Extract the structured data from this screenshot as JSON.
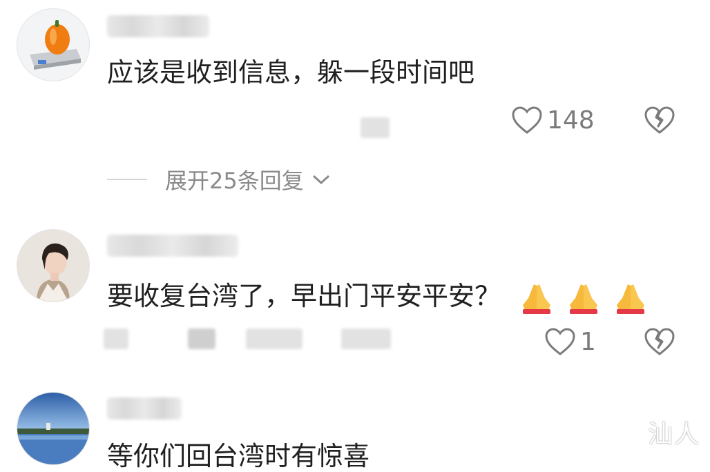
{
  "comments": [
    {
      "text": "应该是收到信息，躲一段时间吧",
      "likes": "148",
      "avatar_icon": "pepper-on-scale-icon"
    },
    {
      "text": "要收复台湾了，早出门平安平安？",
      "likes": "1",
      "emoji": "folded-hands-icon",
      "avatar_icon": "woman-portrait-icon"
    },
    {
      "text": "等你们回台湾时有惊喜",
      "avatar_icon": "lake-landscape-icon"
    }
  ],
  "expand_replies": {
    "label": "展开25条回复"
  },
  "watermark": {
    "text": "汕人"
  },
  "colors": {
    "icon_gray": "#7b7b7b",
    "text": "#202020",
    "muted": "#8a8a8a"
  }
}
